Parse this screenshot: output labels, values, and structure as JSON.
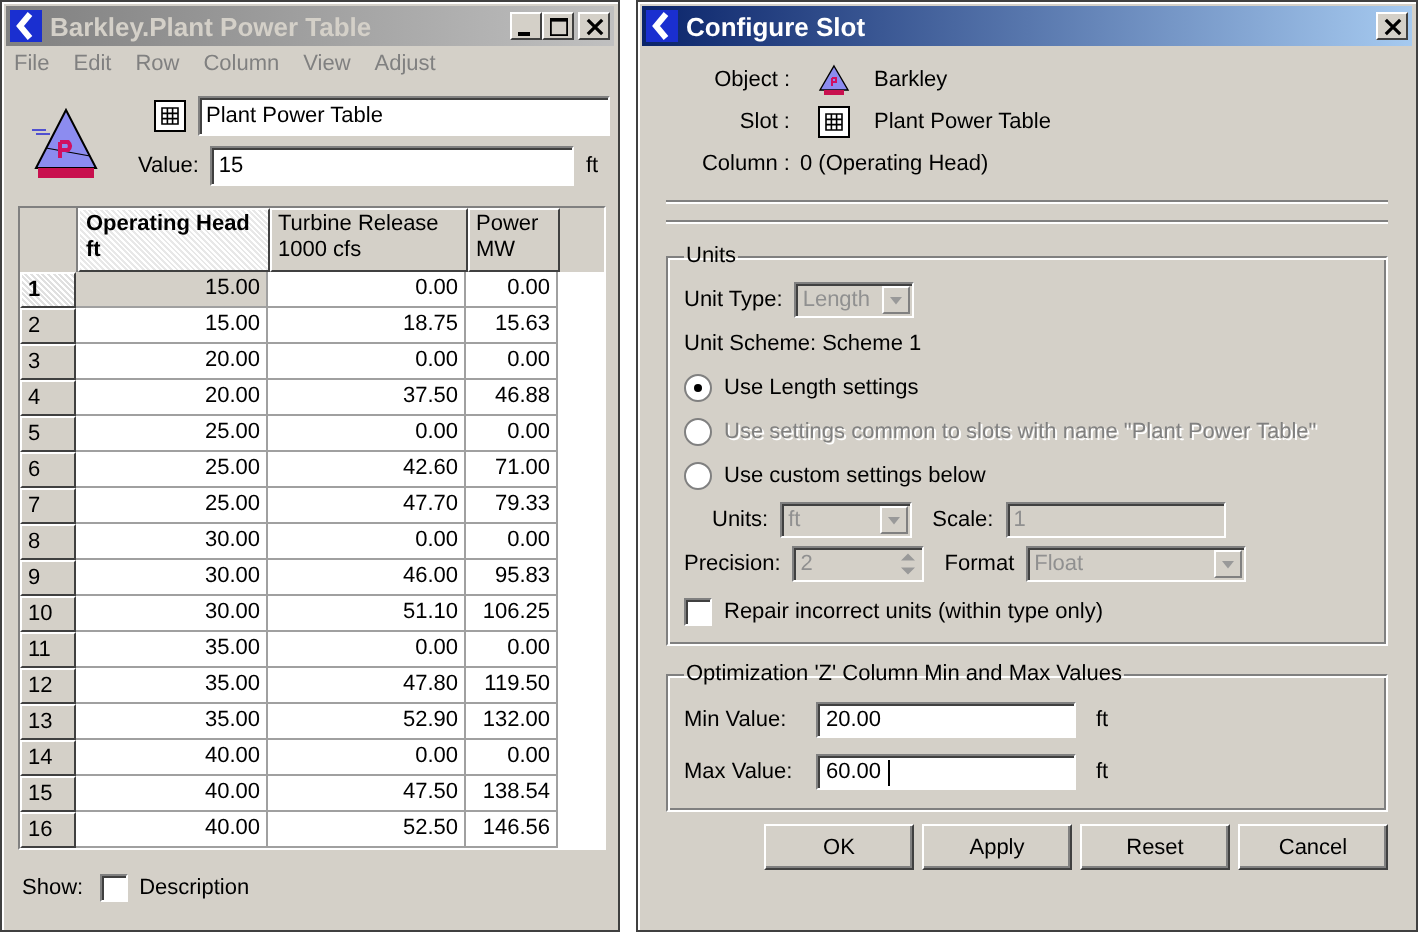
{
  "table_window": {
    "title": "Barkley.Plant Power Table",
    "active": false,
    "menu": [
      "File",
      "Edit",
      "Row",
      "Column",
      "View",
      "Adjust"
    ],
    "slot_name": "Plant Power Table",
    "value_label": "Value:",
    "value": "15",
    "value_unit": "ft",
    "table": {
      "columns": [
        {
          "title": "Operating Head",
          "unit": "ft",
          "selected": true
        },
        {
          "title": "Turbine Release",
          "unit": "1000 cfs",
          "selected": false
        },
        {
          "title": "Power",
          "unit": "MW",
          "selected": false
        }
      ],
      "rows": [
        {
          "number": "1",
          "selected": true,
          "cells": [
            "15.00",
            "0.00",
            "0.00"
          ]
        },
        {
          "number": "2",
          "selected": false,
          "cells": [
            "15.00",
            "18.75",
            "15.63"
          ]
        },
        {
          "number": "3",
          "selected": false,
          "cells": [
            "20.00",
            "0.00",
            "0.00"
          ]
        },
        {
          "number": "4",
          "selected": false,
          "cells": [
            "20.00",
            "37.50",
            "46.88"
          ]
        },
        {
          "number": "5",
          "selected": false,
          "cells": [
            "25.00",
            "0.00",
            "0.00"
          ]
        },
        {
          "number": "6",
          "selected": false,
          "cells": [
            "25.00",
            "42.60",
            "71.00"
          ]
        },
        {
          "number": "7",
          "selected": false,
          "cells": [
            "25.00",
            "47.70",
            "79.33"
          ]
        },
        {
          "number": "8",
          "selected": false,
          "cells": [
            "30.00",
            "0.00",
            "0.00"
          ]
        },
        {
          "number": "9",
          "selected": false,
          "cells": [
            "30.00",
            "46.00",
            "95.83"
          ]
        },
        {
          "number": "10",
          "selected": false,
          "cells": [
            "30.00",
            "51.10",
            "106.25"
          ]
        },
        {
          "number": "11",
          "selected": false,
          "cells": [
            "35.00",
            "0.00",
            "0.00"
          ]
        },
        {
          "number": "12",
          "selected": false,
          "cells": [
            "35.00",
            "47.80",
            "119.50"
          ]
        },
        {
          "number": "13",
          "selected": false,
          "cells": [
            "35.00",
            "52.90",
            "132.00"
          ]
        },
        {
          "number": "14",
          "selected": false,
          "cells": [
            "40.00",
            "0.00",
            "0.00"
          ]
        },
        {
          "number": "15",
          "selected": false,
          "cells": [
            "40.00",
            "47.50",
            "138.54"
          ]
        },
        {
          "number": "16",
          "selected": false,
          "cells": [
            "40.00",
            "52.50",
            "146.56"
          ]
        }
      ]
    },
    "show_label": "Show:",
    "description": {
      "label": "Description",
      "checked": false
    }
  },
  "dialog": {
    "title": "Configure Slot",
    "active": true,
    "info": [
      {
        "label": "Object :",
        "kind": "object",
        "value": "Barkley"
      },
      {
        "label": "Slot :",
        "kind": "slot",
        "value": "Plant Power Table"
      },
      {
        "label": "Column :",
        "kind": "column",
        "value": "0 (Operating Head)"
      }
    ],
    "units": {
      "legend": "Units",
      "unit_type_label": "Unit Type:",
      "unit_type": "Length",
      "scheme": "Unit Scheme: Scheme 1",
      "options": [
        {
          "label": "Use Length settings",
          "selected": true,
          "disabled": false
        },
        {
          "label": "Use settings common to slots with name \"Plant Power Table\"",
          "selected": false,
          "disabled": true
        },
        {
          "label": "Use custom settings below",
          "selected": false,
          "disabled": false
        }
      ],
      "units_label": "Units:",
      "units_value": "ft",
      "scale_label": "Scale:",
      "scale_value": "1",
      "precision_label": "Precision:",
      "precision_value": "2",
      "format_label": "Format",
      "format_value": "Float",
      "repair": {
        "label": "Repair incorrect units (within type only)",
        "checked": false
      }
    },
    "optimization": {
      "legend": "Optimization 'Z' Column Min and Max Values",
      "fields": [
        {
          "label": "Min Value:",
          "value": "20.00",
          "unit": "ft",
          "focused": false
        },
        {
          "label": "Max Value:",
          "value": "60.00",
          "unit": "ft",
          "focused": true
        }
      ]
    },
    "buttons": [
      "OK",
      "Apply",
      "Reset",
      "Cancel"
    ]
  }
}
